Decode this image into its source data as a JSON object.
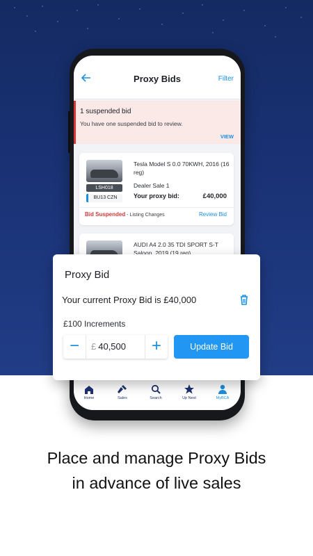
{
  "app": {
    "screen_title": "Proxy Bids",
    "filter_label": "Filter"
  },
  "alert": {
    "title": "1 suspended bid",
    "message": "You have one suspended bid to review.",
    "action": "VIEW"
  },
  "listings": [
    {
      "title": "Tesla Model S 0.0 70KWH, 2016 (16 reg)",
      "reg_badge": "LSH018",
      "reg_plate": "BU13 CZN",
      "sale": "Dealer Sale 1",
      "proxy_label": "Your proxy bid:",
      "proxy_value": "£40,000",
      "status": "Bid Suspended",
      "status_detail": " - Listing Changes",
      "action": "Review Bid"
    },
    {
      "title": "AUDI A4 2.0 35 TDI SPORT S-T Saloon, 2019 (19 reg)"
    }
  ],
  "nav": [
    {
      "label": "Home",
      "icon": "home-icon"
    },
    {
      "label": "Sales",
      "icon": "gavel-icon"
    },
    {
      "label": "Search",
      "icon": "search-icon"
    },
    {
      "label": "Up Next",
      "icon": "star-icon"
    },
    {
      "label": "MyBCA",
      "icon": "person-icon",
      "active": true
    }
  ],
  "modal": {
    "title": "Proxy Bid",
    "current_text": "Your current Proxy Bid is £40,000",
    "increments": "£100 Increments",
    "currency": "£",
    "value": "40,500",
    "minus": "−",
    "plus": "+",
    "update_label": "Update Bid"
  },
  "caption": {
    "line1": "Place and manage Proxy Bids",
    "line2": "in advance of live sales"
  },
  "colors": {
    "accent": "#2196f3",
    "background_top": "#1b3478",
    "alert": "#d63838"
  }
}
